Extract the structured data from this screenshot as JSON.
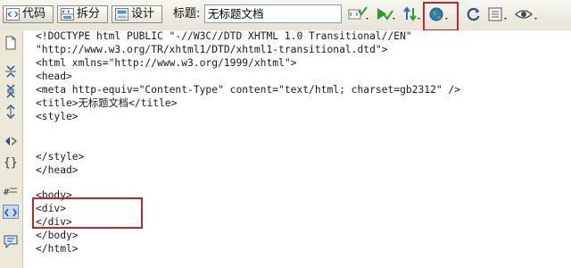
{
  "toolbar": {
    "view_buttons": [
      {
        "label": "代码",
        "icon": "code-view-icon"
      },
      {
        "label": "拆分",
        "icon": "split-view-icon"
      },
      {
        "label": "设计",
        "icon": "design-view-icon"
      }
    ],
    "title_label": "标题:",
    "title_value": "无标题文档",
    "icons": [
      "validate-icon",
      "check-browser-icon",
      "file-management-icon",
      "preview-browser-icon",
      "refresh-icon",
      "view-options-icon",
      "visual-aids-icon"
    ]
  },
  "sidebar": {
    "icons": [
      "open-documents-icon",
      "collapse-tag-icon",
      "collapse-selection-icon",
      "expand-all-icon",
      "select-parent-icon",
      "balance-braces-icon",
      "line-numbers-icon",
      "wrap-tag-icon",
      "comment-icon"
    ]
  },
  "code": {
    "lines": [
      "<!DOCTYPE html PUBLIC \"-//W3C//DTD XHTML 1.0 Transitional//EN\"",
      "\"http://www.w3.org/TR/xhtml1/DTD/xhtml1-transitional.dtd\">",
      "<html xmlns=\"http://www.w3.org/1999/xhtml\">",
      "<head>",
      "<meta http-equiv=\"Content-Type\" content=\"text/html; charset=gb2312\" />",
      "<title>无标题文档</title>",
      "<style>",
      "",
      "",
      "</style>",
      "</head>",
      "",
      "<body>",
      "<div>",
      "</div>",
      "</body>",
      "</html>"
    ]
  },
  "colors": {
    "highlight_box": "#c0262a",
    "toolbar_bg": "#e6e3d6",
    "sidebar_bg": "#ece9d8"
  }
}
